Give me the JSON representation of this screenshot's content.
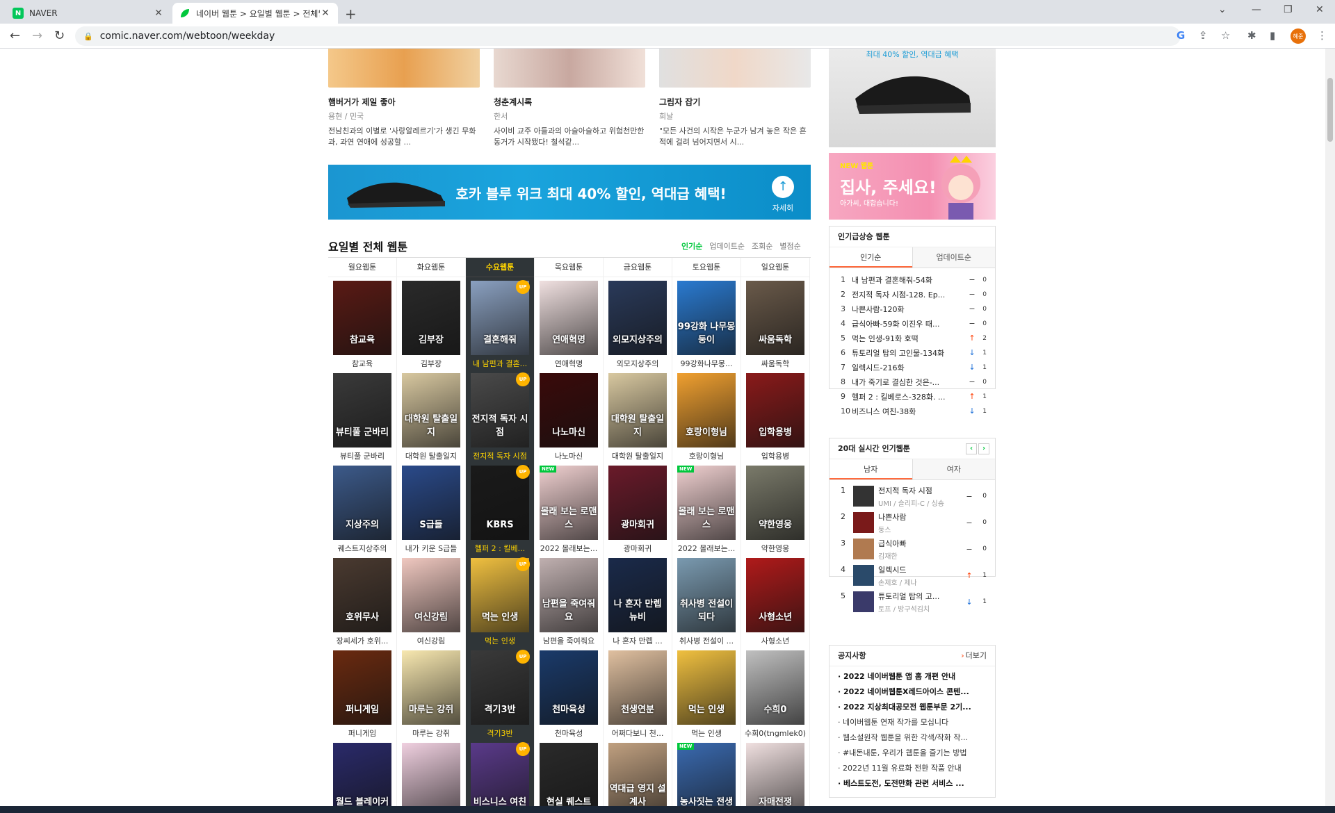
{
  "browser": {
    "tabs": [
      {
        "title": "NAVER",
        "favicon": "N",
        "active": false
      },
      {
        "title": "네이버 웹툰 > 요일별 웹툰 > 전체웹툰",
        "favicon": "leaf",
        "active": true
      }
    ],
    "url": "comic.naver.com/webtoon/weekday",
    "profile_label": "혜준"
  },
  "recommended": [
    {
      "title": "햄버거가 제일 좋아",
      "author": "용현 / 민국",
      "desc": "전남친과의 이별로 '사랑알레르기'가 생긴 무화과, 과연 연애에 성공할 ..."
    },
    {
      "title": "청춘계시록",
      "author": "한서",
      "desc": "사이비 교주 아들과의 아슬아슬하고 위험천만한 동거가 시작됐다! 철석같..."
    },
    {
      "title": "그림자 잡기",
      "author": "희날",
      "desc": "\"모든 사건의 시작은 누군가 남겨 놓은 작은 흔적에 걸려 넘어지면서 시..."
    }
  ],
  "ad_banner": {
    "text": "호카 블루 위크 최대 40% 할인, 역대급 혜택!",
    "more_label": "자세히"
  },
  "weekday": {
    "title": "요일별 전체 웹툰",
    "sorts": [
      "인기순",
      "업데이트순",
      "조회순",
      "별점순"
    ],
    "active_sort": "인기순",
    "columns": [
      {
        "label": "월요웹툰",
        "items": [
          {
            "name": "참교육",
            "cover": "참교육",
            "bg": "#5a1a14"
          },
          {
            "name": "뷰티풀 군바리",
            "cover": "뷰티풀 군바리",
            "bg": "#3a3a3a"
          },
          {
            "name": "퀘스트지상주의",
            "cover": "지상주의",
            "bg": "#3c5a8a"
          },
          {
            "name": "장씨세가 호위...",
            "cover": "호위무사",
            "bg": "#4a3a30"
          },
          {
            "name": "퍼니게임",
            "cover": "퍼니게임",
            "bg": "#6a2a10"
          },
          {
            "name": "",
            "cover": "월드 블레이커",
            "bg": "#2a2a6a"
          }
        ]
      },
      {
        "label": "화요웹툰",
        "items": [
          {
            "name": "김부장",
            "cover": "김부장",
            "bg": "#2a2a2a"
          },
          {
            "name": "대학원 탈출일지",
            "cover": "대학원 탈출일지",
            "bg": "#d8c8a0"
          },
          {
            "name": "내가 키운 S급들",
            "cover": "S급들",
            "bg": "#2a4a8a"
          },
          {
            "name": "여신강림",
            "cover": "여신강림",
            "bg": "#f0c8c0"
          },
          {
            "name": "마루는 강쥐",
            "cover": "마루는 강쥐",
            "bg": "#f8e8b0"
          },
          {
            "name": "",
            "cover": "",
            "bg": "#f0d0e0"
          }
        ]
      },
      {
        "label": "수요웹툰",
        "items": [
          {
            "name": "내 남편과 결혼...",
            "cover": "결혼해줘",
            "bg": "#8aa0c0",
            "up": true
          },
          {
            "name": "전지적 독자 시점",
            "cover": "전지적 독자 시점",
            "bg": "#4a4a4a",
            "up": true
          },
          {
            "name": "헬퍼 2 : 킬베...",
            "cover": "KBRS",
            "bg": "#1a1a1a",
            "up": true
          },
          {
            "name": "먹는 인생",
            "cover": "먹는 인생",
            "bg": "#f0c040",
            "up": true
          },
          {
            "name": "격기3반",
            "cover": "격기3반",
            "bg": "#3a3a3a",
            "up": true
          },
          {
            "name": "",
            "cover": "비스니스 여친",
            "bg": "#5a3a8a",
            "up": true
          }
        ]
      },
      {
        "label": "목요웹툰",
        "items": [
          {
            "name": "연애혁명",
            "cover": "연애혁명",
            "bg": "#f0e0e0"
          },
          {
            "name": "나노마신",
            "cover": "나노마신",
            "bg": "#3a0a0a"
          },
          {
            "name": "2022 몰래보는...",
            "cover": "몰래 보는 로맨스",
            "bg": "#f0d0d0",
            "new": true
          },
          {
            "name": "남편을 죽여줘요",
            "cover": "남편을 죽여줘요",
            "bg": "#c0b0b0"
          },
          {
            "name": "천마육성",
            "cover": "천마육성",
            "bg": "#1a3a6a"
          },
          {
            "name": "",
            "cover": "현실 퀘스트",
            "bg": "#2a2a2a"
          }
        ]
      },
      {
        "label": "금요웹툰",
        "items": [
          {
            "name": "외모지상주의",
            "cover": "외모지상주의",
            "bg": "#2a3a5a"
          },
          {
            "name": "대학원 탈출일지",
            "cover": "대학원 탈출일지",
            "bg": "#d8c8a0"
          },
          {
            "name": "광마회귀",
            "cover": "광마회귀",
            "bg": "#6a1a2a"
          },
          {
            "name": "나 혼자 만렙 ...",
            "cover": "나 혼자 만렙 뉴비",
            "bg": "#1a2a4a"
          },
          {
            "name": "어쩌다보니 천...",
            "cover": "천생연분",
            "bg": "#e0c0a0"
          },
          {
            "name": "",
            "cover": "역대급 영지 설계사",
            "bg": "#c0a080"
          }
        ]
      },
      {
        "label": "토요웹툰",
        "items": [
          {
            "name": "99강화나무몽...",
            "cover": "99강화 나무몽둥이",
            "bg": "#2a7ad0"
          },
          {
            "name": "호랑이형님",
            "cover": "호랑이형님",
            "bg": "#f0a030"
          },
          {
            "name": "2022 몰래보는...",
            "cover": "몰래 보는 로맨스",
            "bg": "#f0d0d0",
            "new": true
          },
          {
            "name": "취사병 전설이 ...",
            "cover": "취사병 전설이 되다",
            "bg": "#7a9ab0"
          },
          {
            "name": "먹는 인생",
            "cover": "먹는 인생",
            "bg": "#f0c040"
          },
          {
            "name": "",
            "cover": "농사짓는 전생",
            "bg": "#3a6ab0",
            "new": true
          }
        ]
      },
      {
        "label": "일요웹툰",
        "items": [
          {
            "name": "싸움독학",
            "cover": "싸움독학",
            "bg": "#6a5a4a"
          },
          {
            "name": "입학용병",
            "cover": "입학용병",
            "bg": "#8a1a1a"
          },
          {
            "name": "약한영웅",
            "cover": "약한영웅",
            "bg": "#7a7a6a"
          },
          {
            "name": "사형소년",
            "cover": "사형소년",
            "bg": "#b01a1a"
          },
          {
            "name": "수희0(tngmlek0)",
            "cover": "수희0",
            "bg": "#c0c0c0"
          },
          {
            "name": "",
            "cover": "자매전쟁",
            "bg": "#f0e0e0"
          }
        ]
      }
    ]
  },
  "sidebar": {
    "top_ad": {
      "caption": "최대 40% 할인, 역대급 혜택"
    },
    "promo": {
      "tag": "NEW 웹툰",
      "title": "집사, 주세요!",
      "subtitle": "아가씨, 대합습니다!"
    },
    "rising": {
      "title": "인기급상승 웹툰",
      "tabs": [
        "인기순",
        "업데이트순"
      ],
      "items": [
        {
          "no": "1",
          "title": "내 남편과 결혼해줘-54화",
          "dir": "same",
          "count": "0"
        },
        {
          "no": "2",
          "title": "전지적 독자 시점-128. Ep...",
          "dir": "same",
          "count": "0"
        },
        {
          "no": "3",
          "title": "나쁜사람-120화",
          "dir": "same",
          "count": "0"
        },
        {
          "no": "4",
          "title": "급식아빠-59화 이진우 때...",
          "dir": "same",
          "count": "0"
        },
        {
          "no": "5",
          "title": "먹는 인생-91화 호떡",
          "dir": "up",
          "count": "2"
        },
        {
          "no": "6",
          "title": "튜토리얼 탑의 고인물-134화",
          "dir": "down",
          "count": "1"
        },
        {
          "no": "7",
          "title": "일렉시드-216화",
          "dir": "down",
          "count": "1"
        },
        {
          "no": "8",
          "title": "내가 죽기로 결심한 것은-...",
          "dir": "same",
          "count": "0"
        },
        {
          "no": "9",
          "title": "헬퍼 2 : 킬베로스-328화. ...",
          "dir": "up",
          "count": "1"
        },
        {
          "no": "10",
          "title": "비즈니스 여친-38화",
          "dir": "down",
          "count": "1"
        }
      ]
    },
    "realtime": {
      "title": "20대 실시간 인기웹툰",
      "tabs": [
        "남자",
        "여자"
      ],
      "items": [
        {
          "no": "1",
          "title": "전지적 독자 시점",
          "author": "UMI / 슬리피-C / 싱숑",
          "dir": "same",
          "count": "0",
          "bg": "#333"
        },
        {
          "no": "2",
          "title": "나쁜사람",
          "author": "둥스",
          "dir": "same",
          "count": "0",
          "bg": "#7a1a1a"
        },
        {
          "no": "3",
          "title": "급식아빠",
          "author": "김재한",
          "dir": "same",
          "count": "0",
          "bg": "#b07a50"
        },
        {
          "no": "4",
          "title": "일렉시드",
          "author": "손제호 / 제나",
          "dir": "up",
          "count": "1",
          "bg": "#2a4a6a"
        },
        {
          "no": "5",
          "title": "튜토리얼 탑의 고...",
          "author": "토프 / 방구석김치",
          "dir": "down",
          "count": "1",
          "bg": "#3a3a6a"
        }
      ]
    },
    "notices": {
      "title": "공지사항",
      "more_label": "더보기",
      "items": [
        {
          "text": "2022 네이버웹툰 앱 홈 개편 안내",
          "bold": true
        },
        {
          "text": "2022 네이버웹툰X레드아이스 콘텐...",
          "bold": true
        },
        {
          "text": "2022 지상최대공모전 웹툰부문 2기...",
          "bold": true
        },
        {
          "text": "네이버웹툰 연재 작가를 모십니다",
          "bold": false
        },
        {
          "text": "웹소설원작 웹툰을 위한 각색/작화 작...",
          "bold": false
        },
        {
          "text": "#내돈내툰, 우리가 웹툰을 즐기는 방법",
          "bold": false
        },
        {
          "text": "2022년 11월 유료화 전환 작품 안내",
          "bold": false
        },
        {
          "text": "베스트도전, 도전만화 관련 서비스 ...",
          "bold": true
        }
      ]
    }
  },
  "colors": {
    "naver_green": "#00c73c",
    "highlight_col": "#2f3538",
    "highlight_text": "#ffd400",
    "up": "#ff3b00",
    "down": "#1a6ed8"
  }
}
